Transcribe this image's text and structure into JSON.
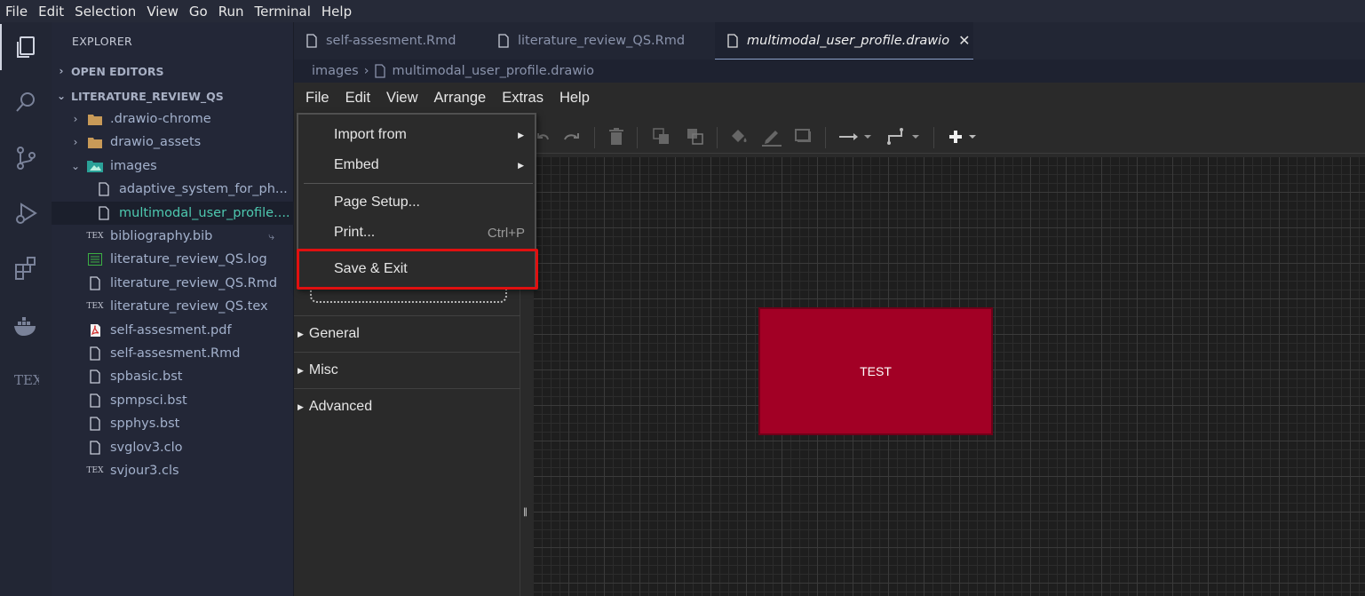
{
  "menubar": [
    "File",
    "Edit",
    "Selection",
    "View",
    "Go",
    "Run",
    "Terminal",
    "Help"
  ],
  "sidebar": {
    "title": "EXPLORER",
    "open_editors": "OPEN EDITORS",
    "project": "LITERATURE_REVIEW_QS",
    "items": [
      {
        "label": ".drawio-chrome",
        "type": "folder",
        "expanded": false
      },
      {
        "label": "drawio_assets",
        "type": "folder",
        "expanded": false
      },
      {
        "label": "images",
        "type": "folder-images",
        "expanded": true
      },
      {
        "label": "adaptive_system_for_ph...",
        "type": "file",
        "nested": true
      },
      {
        "label": "multimodal_user_profile....",
        "type": "file",
        "nested": true,
        "selected": true
      },
      {
        "label": "bibliography.bib",
        "type": "tex",
        "badge": "⤷"
      },
      {
        "label": "literature_review_QS.log",
        "type": "log"
      },
      {
        "label": "literature_review_QS.Rmd",
        "type": "file"
      },
      {
        "label": "literature_review_QS.tex",
        "type": "tex"
      },
      {
        "label": "self-assesment.pdf",
        "type": "pdf"
      },
      {
        "label": "self-assesment.Rmd",
        "type": "file"
      },
      {
        "label": "spbasic.bst",
        "type": "file"
      },
      {
        "label": "spmpsci.bst",
        "type": "file"
      },
      {
        "label": "spphys.bst",
        "type": "file"
      },
      {
        "label": "svglov3.clo",
        "type": "file"
      },
      {
        "label": "svjour3.cls",
        "type": "tex"
      }
    ]
  },
  "tabs": [
    {
      "label": "self-assesment.Rmd",
      "active": false
    },
    {
      "label": "literature_review_QS.Rmd",
      "active": false
    },
    {
      "label": "multimodal_user_profile.drawio",
      "active": true
    }
  ],
  "breadcrumb": {
    "folder": "images",
    "file": "multimodal_user_profile.drawio"
  },
  "drawio": {
    "menu": [
      "File",
      "Edit",
      "View",
      "Arrange",
      "Extras",
      "Help"
    ],
    "panel_sections": [
      "General",
      "Misc",
      "Advanced"
    ],
    "shape_label": "TEST",
    "shape_fill": "#a20025"
  },
  "file_menu": {
    "items": [
      {
        "label": "Import from",
        "submenu": true
      },
      {
        "label": "Embed",
        "submenu": true
      },
      {
        "label": "Page Setup..."
      },
      {
        "label": "Print...",
        "shortcut": "Ctrl+P"
      },
      {
        "label": "Save & Exit",
        "highlighted": true
      }
    ]
  },
  "colors": {
    "highlight": "#e01010",
    "accent": "#8aa0c8"
  }
}
